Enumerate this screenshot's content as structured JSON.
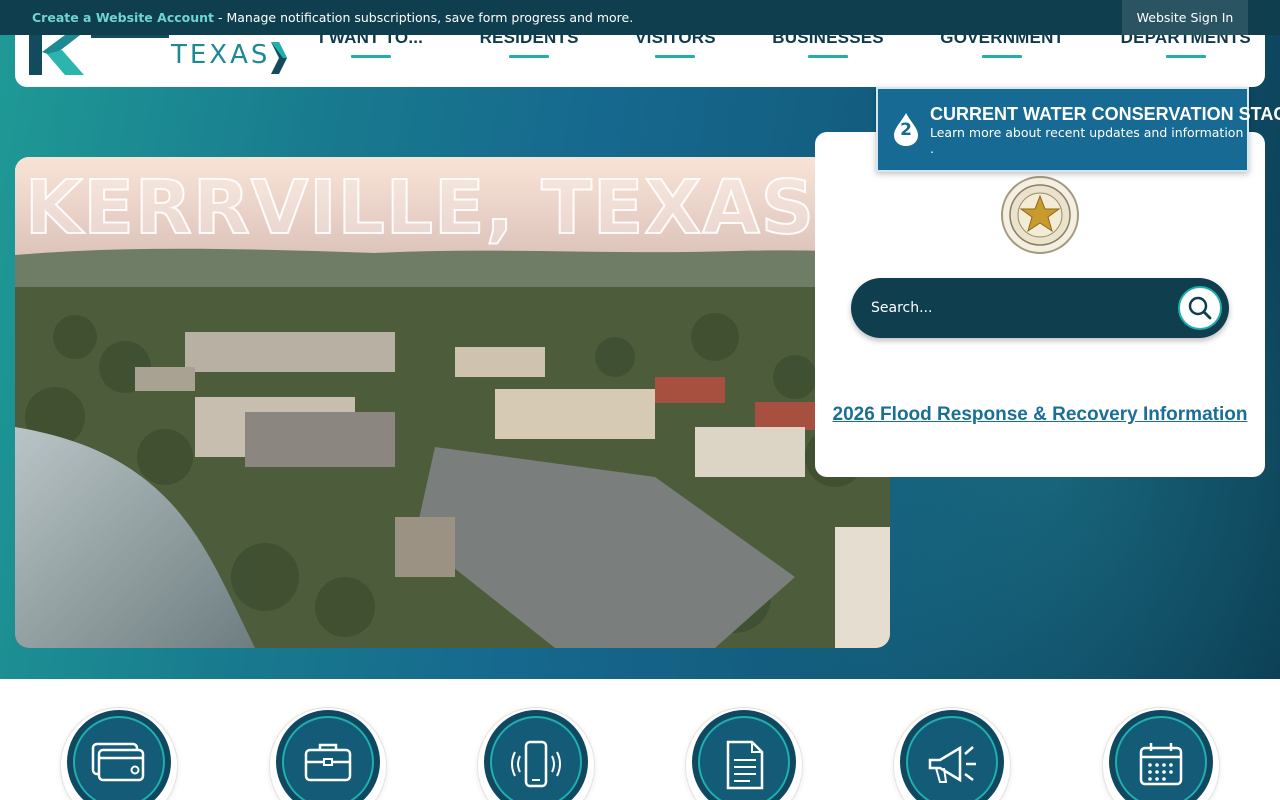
{
  "notification": {
    "link_text": "Create a Website Account",
    "description": " - Manage notification subscriptions, save form progress and more.",
    "sign_in_label": "Website Sign In"
  },
  "logo": {
    "city_text": "KERRVILLE",
    "state_text": "TEXAS"
  },
  "nav": {
    "items": [
      {
        "label": "I WANT TO..."
      },
      {
        "label": "RESIDENTS"
      },
      {
        "label": "VISITORS"
      },
      {
        "label": "BUSINESSES"
      },
      {
        "label": "GOVERNMENT"
      },
      {
        "label": "DEPARTMENTS"
      }
    ]
  },
  "hero": {
    "title": "KERRVILLE, TEXAS"
  },
  "alert": {
    "stage_number": "2",
    "title": "CURRENT WATER CONSERVATION STAGE",
    "description": "Learn more about recent updates and information ."
  },
  "search": {
    "placeholder": "Search...",
    "seal_icon": "city-seal",
    "button_icon": "search-icon"
  },
  "flood_link": {
    "label": "2026 Flood Response & Recovery Information"
  },
  "quick_links": {
    "icons": [
      "credit-card-icon",
      "briefcase-icon",
      "mobile-phone-icon",
      "document-icon",
      "megaphone-icon",
      "calendar-icon"
    ]
  },
  "colors": {
    "accent_teal": "#1fb0ac",
    "navy": "#0f3e4f",
    "alert_blue": "#166a94",
    "link_blue": "#1a6f96"
  }
}
